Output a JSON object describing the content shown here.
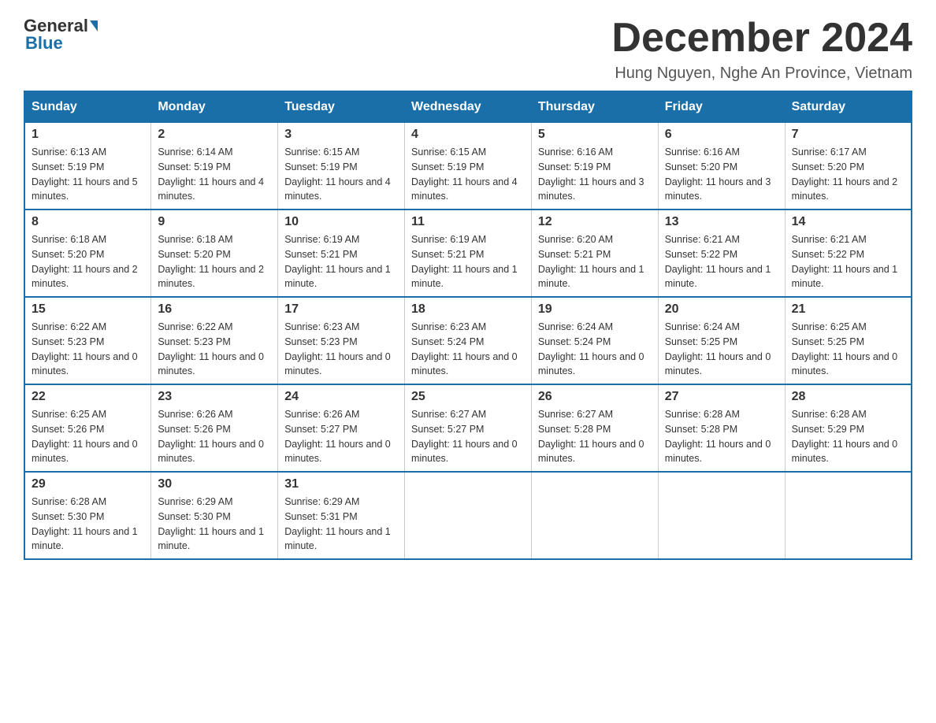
{
  "header": {
    "logo_general": "General",
    "logo_blue": "Blue",
    "month_title": "December 2024",
    "location": "Hung Nguyen, Nghe An Province, Vietnam"
  },
  "weekdays": [
    "Sunday",
    "Monday",
    "Tuesday",
    "Wednesday",
    "Thursday",
    "Friday",
    "Saturday"
  ],
  "weeks": [
    [
      {
        "day": "1",
        "sunrise": "6:13 AM",
        "sunset": "5:19 PM",
        "daylight": "11 hours and 5 minutes."
      },
      {
        "day": "2",
        "sunrise": "6:14 AM",
        "sunset": "5:19 PM",
        "daylight": "11 hours and 4 minutes."
      },
      {
        "day": "3",
        "sunrise": "6:15 AM",
        "sunset": "5:19 PM",
        "daylight": "11 hours and 4 minutes."
      },
      {
        "day": "4",
        "sunrise": "6:15 AM",
        "sunset": "5:19 PM",
        "daylight": "11 hours and 4 minutes."
      },
      {
        "day": "5",
        "sunrise": "6:16 AM",
        "sunset": "5:19 PM",
        "daylight": "11 hours and 3 minutes."
      },
      {
        "day": "6",
        "sunrise": "6:16 AM",
        "sunset": "5:20 PM",
        "daylight": "11 hours and 3 minutes."
      },
      {
        "day": "7",
        "sunrise": "6:17 AM",
        "sunset": "5:20 PM",
        "daylight": "11 hours and 2 minutes."
      }
    ],
    [
      {
        "day": "8",
        "sunrise": "6:18 AM",
        "sunset": "5:20 PM",
        "daylight": "11 hours and 2 minutes."
      },
      {
        "day": "9",
        "sunrise": "6:18 AM",
        "sunset": "5:20 PM",
        "daylight": "11 hours and 2 minutes."
      },
      {
        "day": "10",
        "sunrise": "6:19 AM",
        "sunset": "5:21 PM",
        "daylight": "11 hours and 1 minute."
      },
      {
        "day": "11",
        "sunrise": "6:19 AM",
        "sunset": "5:21 PM",
        "daylight": "11 hours and 1 minute."
      },
      {
        "day": "12",
        "sunrise": "6:20 AM",
        "sunset": "5:21 PM",
        "daylight": "11 hours and 1 minute."
      },
      {
        "day": "13",
        "sunrise": "6:21 AM",
        "sunset": "5:22 PM",
        "daylight": "11 hours and 1 minute."
      },
      {
        "day": "14",
        "sunrise": "6:21 AM",
        "sunset": "5:22 PM",
        "daylight": "11 hours and 1 minute."
      }
    ],
    [
      {
        "day": "15",
        "sunrise": "6:22 AM",
        "sunset": "5:23 PM",
        "daylight": "11 hours and 0 minutes."
      },
      {
        "day": "16",
        "sunrise": "6:22 AM",
        "sunset": "5:23 PM",
        "daylight": "11 hours and 0 minutes."
      },
      {
        "day": "17",
        "sunrise": "6:23 AM",
        "sunset": "5:23 PM",
        "daylight": "11 hours and 0 minutes."
      },
      {
        "day": "18",
        "sunrise": "6:23 AM",
        "sunset": "5:24 PM",
        "daylight": "11 hours and 0 minutes."
      },
      {
        "day": "19",
        "sunrise": "6:24 AM",
        "sunset": "5:24 PM",
        "daylight": "11 hours and 0 minutes."
      },
      {
        "day": "20",
        "sunrise": "6:24 AM",
        "sunset": "5:25 PM",
        "daylight": "11 hours and 0 minutes."
      },
      {
        "day": "21",
        "sunrise": "6:25 AM",
        "sunset": "5:25 PM",
        "daylight": "11 hours and 0 minutes."
      }
    ],
    [
      {
        "day": "22",
        "sunrise": "6:25 AM",
        "sunset": "5:26 PM",
        "daylight": "11 hours and 0 minutes."
      },
      {
        "day": "23",
        "sunrise": "6:26 AM",
        "sunset": "5:26 PM",
        "daylight": "11 hours and 0 minutes."
      },
      {
        "day": "24",
        "sunrise": "6:26 AM",
        "sunset": "5:27 PM",
        "daylight": "11 hours and 0 minutes."
      },
      {
        "day": "25",
        "sunrise": "6:27 AM",
        "sunset": "5:27 PM",
        "daylight": "11 hours and 0 minutes."
      },
      {
        "day": "26",
        "sunrise": "6:27 AM",
        "sunset": "5:28 PM",
        "daylight": "11 hours and 0 minutes."
      },
      {
        "day": "27",
        "sunrise": "6:28 AM",
        "sunset": "5:28 PM",
        "daylight": "11 hours and 0 minutes."
      },
      {
        "day": "28",
        "sunrise": "6:28 AM",
        "sunset": "5:29 PM",
        "daylight": "11 hours and 0 minutes."
      }
    ],
    [
      {
        "day": "29",
        "sunrise": "6:28 AM",
        "sunset": "5:30 PM",
        "daylight": "11 hours and 1 minute."
      },
      {
        "day": "30",
        "sunrise": "6:29 AM",
        "sunset": "5:30 PM",
        "daylight": "11 hours and 1 minute."
      },
      {
        "day": "31",
        "sunrise": "6:29 AM",
        "sunset": "5:31 PM",
        "daylight": "11 hours and 1 minute."
      },
      null,
      null,
      null,
      null
    ]
  ],
  "labels": {
    "sunrise": "Sunrise:",
    "sunset": "Sunset:",
    "daylight": "Daylight:"
  }
}
